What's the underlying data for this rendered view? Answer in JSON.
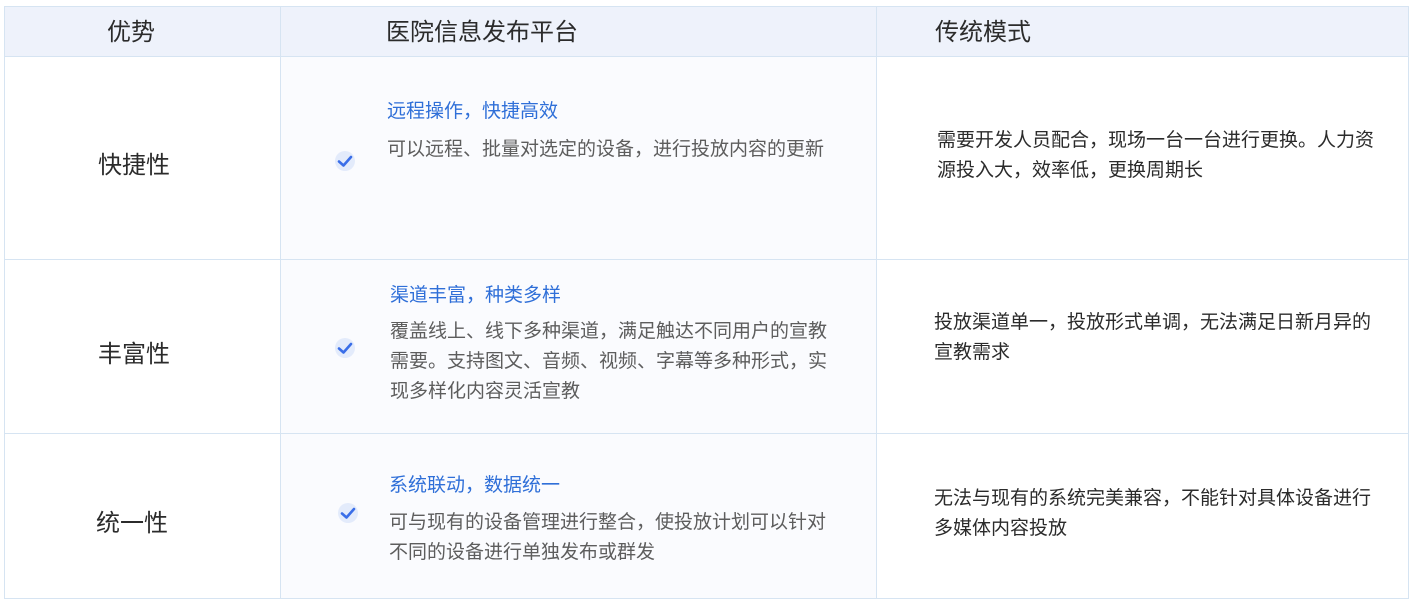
{
  "header": {
    "col_advantage": "优势",
    "col_platform": "医院信息发布平台",
    "col_traditional": "传统模式"
  },
  "rows": [
    {
      "advantage": "快捷性",
      "platform_title": "远程操作，快捷高效",
      "platform_desc": "可以远程、批量对选定的设备，进行投放内容的更新",
      "traditional": "需要开发人员配合，现场一台一台进行更换。人力资源投入大，效率低，更换周期长"
    },
    {
      "advantage": "丰富性",
      "platform_title": "渠道丰富，种类多样",
      "platform_desc": "覆盖线上、线下多种渠道，满足触达不同用户的宣教需要。支持图文、音频、视频、字幕等多种形式，实现多样化内容灵活宣教",
      "traditional": "投放渠道单一，投放形式单调，无法满足日新月异的宣教需求"
    },
    {
      "advantage": "统一性",
      "platform_title": "系统联动，数据统一",
      "platform_desc": "可与现有的设备管理进行整合，使投放计划可以针对不同的设备进行单独发布或群发",
      "traditional": "无法与现有的系统完美兼容，不能针对具体设备进行多媒体内容投放"
    }
  ],
  "icons": {
    "check": "check-circle-icon"
  },
  "colors": {
    "header_bg": "#eef2fb",
    "border": "#d6e4f2",
    "accent": "#2f6fd8",
    "check_blue": "#3a6ee8"
  }
}
